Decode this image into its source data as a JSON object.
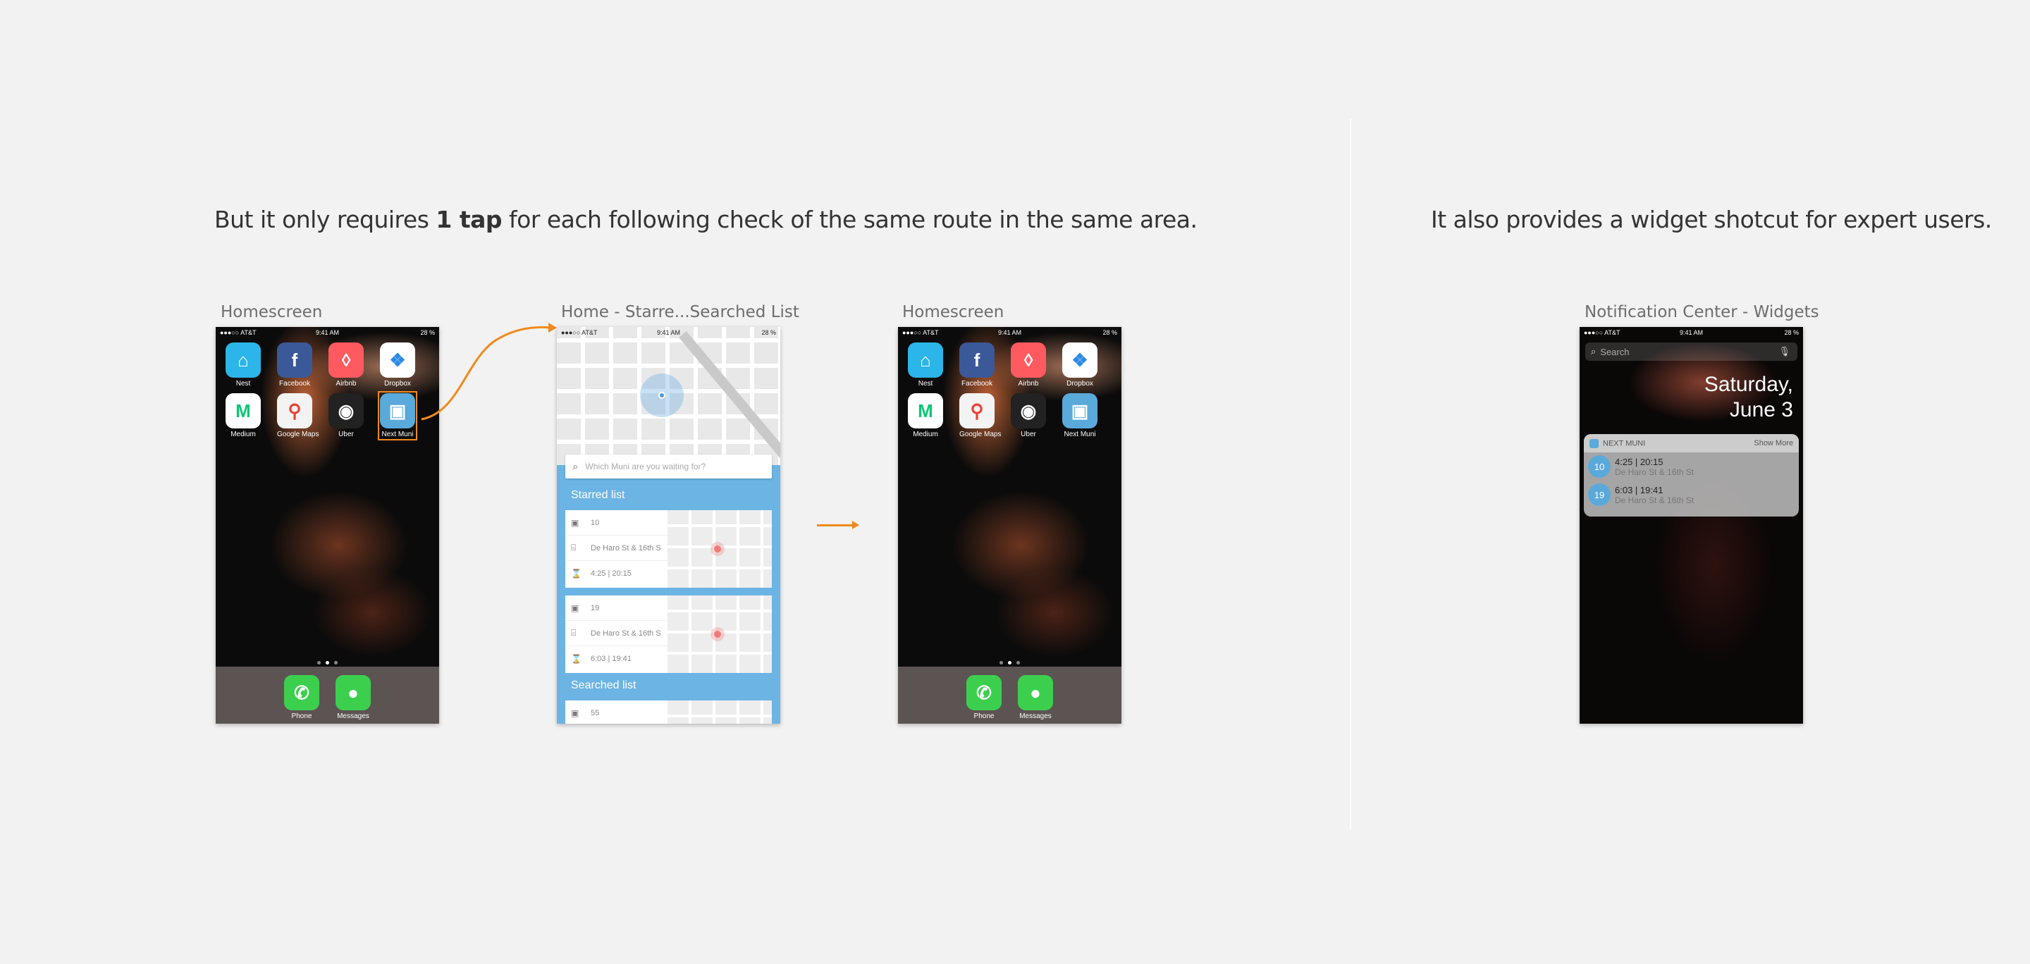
{
  "headlines": {
    "left_prefix": "But it only requires ",
    "left_bold": "1 tap",
    "left_suffix": " for each following check of the same route in the same area.",
    "right": "It also provides a widget shotcut for expert users."
  },
  "colors": {
    "accent": "#f08a1c",
    "muni_blue": "#6cb4e4"
  },
  "screens": [
    {
      "label": "Homescreen"
    },
    {
      "label": "Home - Starre...Searched List"
    },
    {
      "label": "Homescreen"
    },
    {
      "label": "Notification Center - Widgets"
    }
  ],
  "status": {
    "carrier": "●●●○○ AT&T",
    "time": "9:41 AM",
    "battery": "28 %"
  },
  "home": {
    "apps": [
      {
        "label": "Nest",
        "icon": "home-icon",
        "glyph": "⌂",
        "color": "#2bb5e8"
      },
      {
        "label": "Facebook",
        "icon": "facebook-icon",
        "glyph": "f",
        "color": "#3b5998"
      },
      {
        "label": "Airbnb",
        "icon": "airbnb-icon",
        "glyph": "◊",
        "color": "#ff5a5f"
      },
      {
        "label": "Dropbox",
        "icon": "dropbox-icon",
        "glyph": "❖",
        "color": "#ffffff"
      },
      {
        "label": "Medium",
        "icon": "medium-icon",
        "glyph": "M",
        "color": "#ffffff"
      },
      {
        "label": "Google Maps",
        "icon": "map-pin-icon",
        "glyph": "⚲",
        "color": "#f3f3f3"
      },
      {
        "label": "Uber",
        "icon": "uber-icon",
        "glyph": "◉",
        "color": "#222222"
      },
      {
        "label": "Next Muni",
        "icon": "bus-icon",
        "glyph": "▣",
        "color": "#5aa9db"
      }
    ],
    "dock": [
      {
        "label": "Phone",
        "icon": "phone-icon",
        "glyph": "✆"
      },
      {
        "label": "Messages",
        "icon": "messages-icon",
        "glyph": "💬"
      }
    ]
  },
  "list": {
    "search_placeholder": "Which Muni are you waiting for?",
    "starred_title": "Starred list",
    "searched_title": "Searched list",
    "cards": [
      {
        "route": "10",
        "stop": "De Haro St & 16th S",
        "times": "4:25 | 20:15"
      },
      {
        "route": "19",
        "stop": "De Haro St & 16th S",
        "times": "6:03 | 19:41"
      }
    ],
    "searched": [
      {
        "route": "55"
      }
    ]
  },
  "notification": {
    "search": "Search",
    "day": "Saturday,",
    "date": "June 3",
    "widget_title": "NEXT MUNI",
    "show_more": "Show More",
    "items": [
      {
        "route": "10",
        "times": "4:25 | 20:15",
        "stop": "De Haro St & 16th St"
      },
      {
        "route": "19",
        "times": "6:03 | 19:41",
        "stop": "De Haro St & 16th St"
      }
    ]
  }
}
